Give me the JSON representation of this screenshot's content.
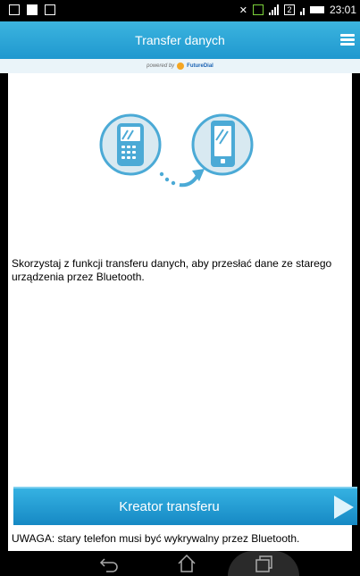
{
  "status_bar": {
    "time": "23:01",
    "sim2_label": "2"
  },
  "app_bar": {
    "title": "Transfer danych"
  },
  "powered_by": {
    "prefix": "powered by",
    "brand": "FutureDial"
  },
  "main": {
    "description": "Skorzystaj z funkcji transferu danych, aby przesłać dane ze starego urządzenia przez Bluetooth.",
    "cta_label": "Kreator transferu",
    "note": "UWAGA: stary telefon musi być wykrywalny przez Bluetooth."
  },
  "colors": {
    "accent": "#1f98cf",
    "button": "#1689c4",
    "icon_circle": "#d8e9f1",
    "icon_blue": "#4baad6"
  }
}
